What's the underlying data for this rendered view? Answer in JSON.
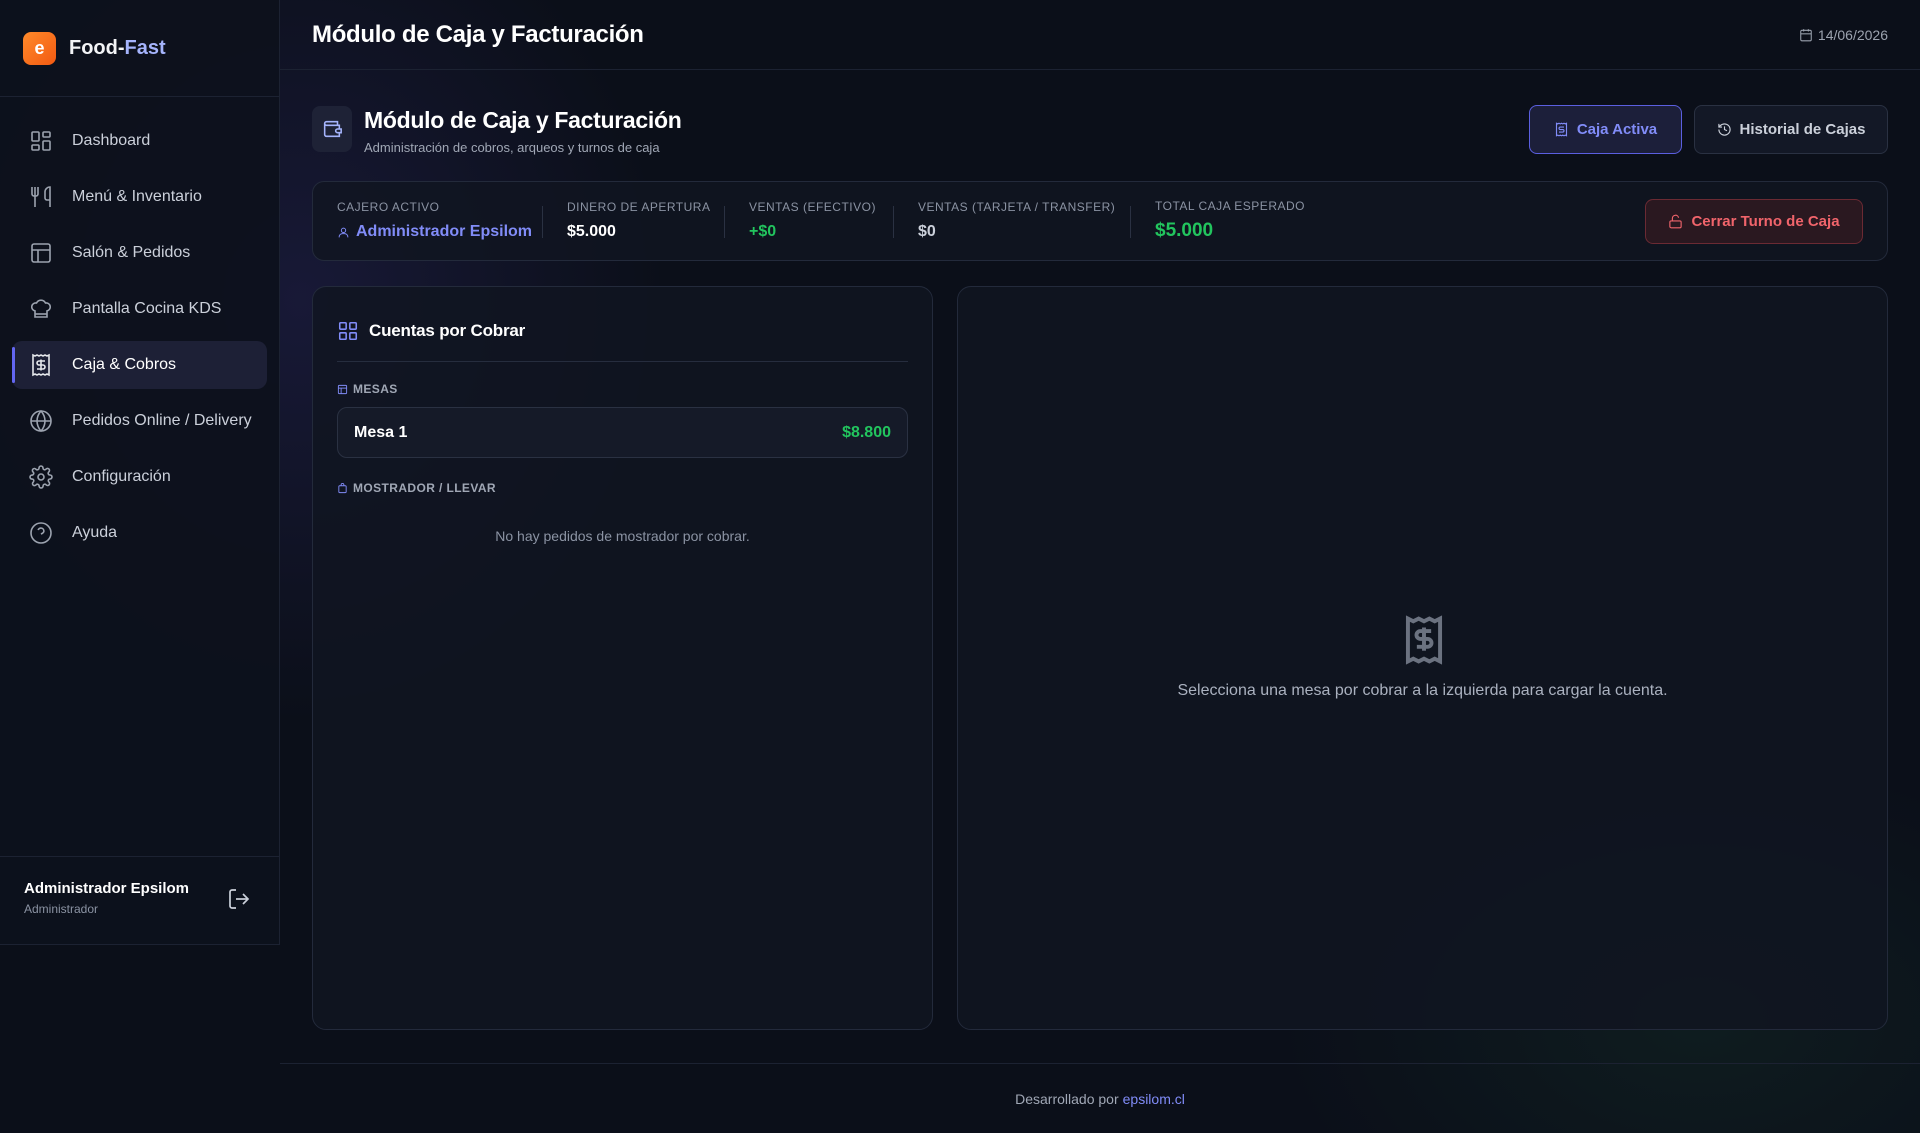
{
  "brand": {
    "name_part1": "Food-",
    "name_part2": "Fast",
    "logo_text": "e"
  },
  "sidebar": {
    "items": [
      {
        "label": "Dashboard",
        "icon": "dashboard-icon"
      },
      {
        "label": "Menú & Inventario",
        "icon": "utensils-icon"
      },
      {
        "label": "Salón & Pedidos",
        "icon": "layout-icon"
      },
      {
        "label": "Pantalla Cocina KDS",
        "icon": "chef-hat-icon"
      },
      {
        "label": "Caja & Cobros",
        "icon": "receipt-icon",
        "active": true
      },
      {
        "label": "Pedidos Online / Delivery",
        "icon": "globe-icon"
      },
      {
        "label": "Configuración",
        "icon": "gear-icon"
      },
      {
        "label": "Ayuda",
        "icon": "help-icon"
      }
    ]
  },
  "user": {
    "name": "Administrador Epsilom",
    "role": "Administrador"
  },
  "topbar": {
    "title": "Módulo de Caja y Facturación",
    "date": "14/06/2026"
  },
  "page_header": {
    "title": "Módulo de Caja y Facturación",
    "subtitle": "Administración de cobros, arqueos y turnos de caja",
    "btn_active": "Caja Activa",
    "btn_history": "Historial de Cajas"
  },
  "stats": {
    "cashier_label": "CAJERO ACTIVO",
    "cashier_value": "Administrador Epsilom",
    "opening_label": "DINERO DE APERTURA",
    "opening_value": "$5.000",
    "cash_label": "VENTAS (EFECTIVO)",
    "cash_value": "+$0",
    "card_label": "VENTAS (TARJETA / TRANSFER)",
    "card_value": "$0",
    "total_label": "TOTAL CAJA ESPERADO",
    "total_value": "$5.000",
    "close_button": "Cerrar Turno de Caja"
  },
  "accounts": {
    "title": "Cuentas por Cobrar",
    "tables_label": "MESAS",
    "tables": [
      {
        "name": "Mesa 1",
        "amount": "$8.800"
      }
    ],
    "counter_label": "MOSTRADOR / LLEVAR",
    "counter_empty": "No hay pedidos de mostrador por cobrar."
  },
  "detail": {
    "empty_text": "Selecciona una mesa por cobrar a la izquierda para cargar la cuenta."
  },
  "footer": {
    "text": "Desarrollado por",
    "link": "epsilom.cl"
  },
  "colors": {
    "accent": "#6366f1",
    "success": "#22c55e",
    "danger": "#f0646b",
    "brand": "#f25a12"
  }
}
